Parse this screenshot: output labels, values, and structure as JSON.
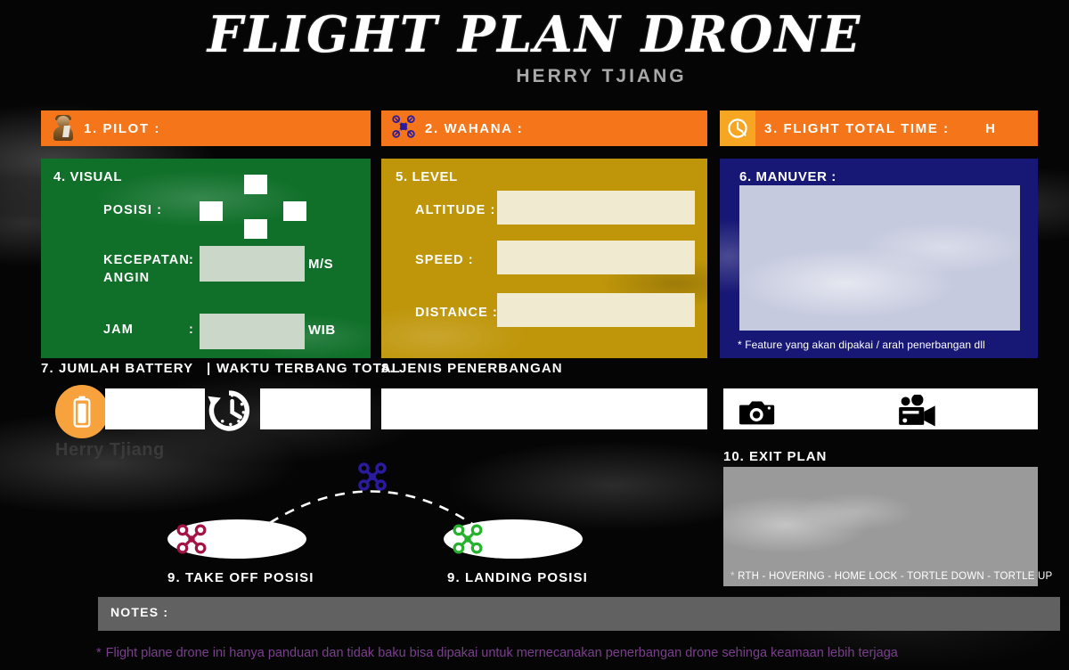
{
  "header": {
    "title": "FLIGHT PLAN DRONE",
    "author": "HERRY TJIANG"
  },
  "watermark": "Herry Tjiang",
  "top_bars": [
    {
      "id": "pilot",
      "label": "1. PILOT :",
      "icon": "pilot-person-icon",
      "color": "#f4751a",
      "suffix": ""
    },
    {
      "id": "wahana",
      "label": "2. WAHANA :",
      "icon": "drone-icon",
      "color": "#f4751a",
      "suffix": ""
    },
    {
      "id": "time",
      "label": "3. FLIGHT TOTAL TIME :",
      "icon": "clock-drone-icon",
      "color": "#f4751a",
      "suffix": "H"
    }
  ],
  "visual_panel": {
    "title": "4. VISUAL",
    "color": "#10702a",
    "posisi_label": "POSISI :",
    "posisi_checkboxes": 4,
    "kecepatan_label_line1": "KECEPATAN",
    "kecepatan_label_line2": "ANGIN",
    "kecepatan_colon": ":",
    "kecepatan_value": "",
    "kecepatan_unit": "M/S",
    "jam_label": "JAM",
    "jam_colon": ":",
    "jam_value": "",
    "jam_unit": "WIB"
  },
  "level_panel": {
    "title": "5. LEVEL",
    "color": "#bf960a",
    "fields": [
      {
        "label": "ALTITUDE :",
        "value": ""
      },
      {
        "label": "SPEED :",
        "value": ""
      },
      {
        "label": "DISTANCE :",
        "value": ""
      }
    ]
  },
  "manuver_panel": {
    "title": "6. MANUVER :",
    "color": "#171775",
    "value": "",
    "note": "* Feature yang akan dipakai / arah penerbangan dll"
  },
  "battery_row": {
    "label_battery": "7. JUMLAH BATTERY",
    "separator": "|",
    "label_flighttime": "WAKTU TERBANG TOTAL",
    "battery_icon": "battery-icon",
    "clock_icon": "clock-history-icon",
    "battery_value": "",
    "flighttime_value": ""
  },
  "flight_type": {
    "label": "8. JENIS PENERBANGAN",
    "value": ""
  },
  "media_row": {
    "icons": [
      "photo-camera-icon",
      "video-camera-icon"
    ],
    "value": ""
  },
  "flight_path": {
    "takeoff_label": "9. TAKE OFF POSISI",
    "landing_label": "9. LANDING POSISI",
    "takeoff_drone_color": "#a31243",
    "apex_drone_color": "#2a1a9e",
    "landing_drone_color": "#24b22a"
  },
  "exit_plan": {
    "title": "10. EXIT PLAN",
    "value": "",
    "note_star": "*",
    "note": "RTH - HOVERING - HOME LOCK - TORTLE DOWN - TORTLE UP"
  },
  "notes": {
    "label": "NOTES :",
    "value": ""
  },
  "disclaimer": {
    "star": "*",
    "text": "Flight plane drone ini hanya panduan dan tidak baku bisa dipakai untuk mernecanakan penerbangan drone sehinga keamaan lebih terjaga",
    "color": "#7b3f8e"
  }
}
